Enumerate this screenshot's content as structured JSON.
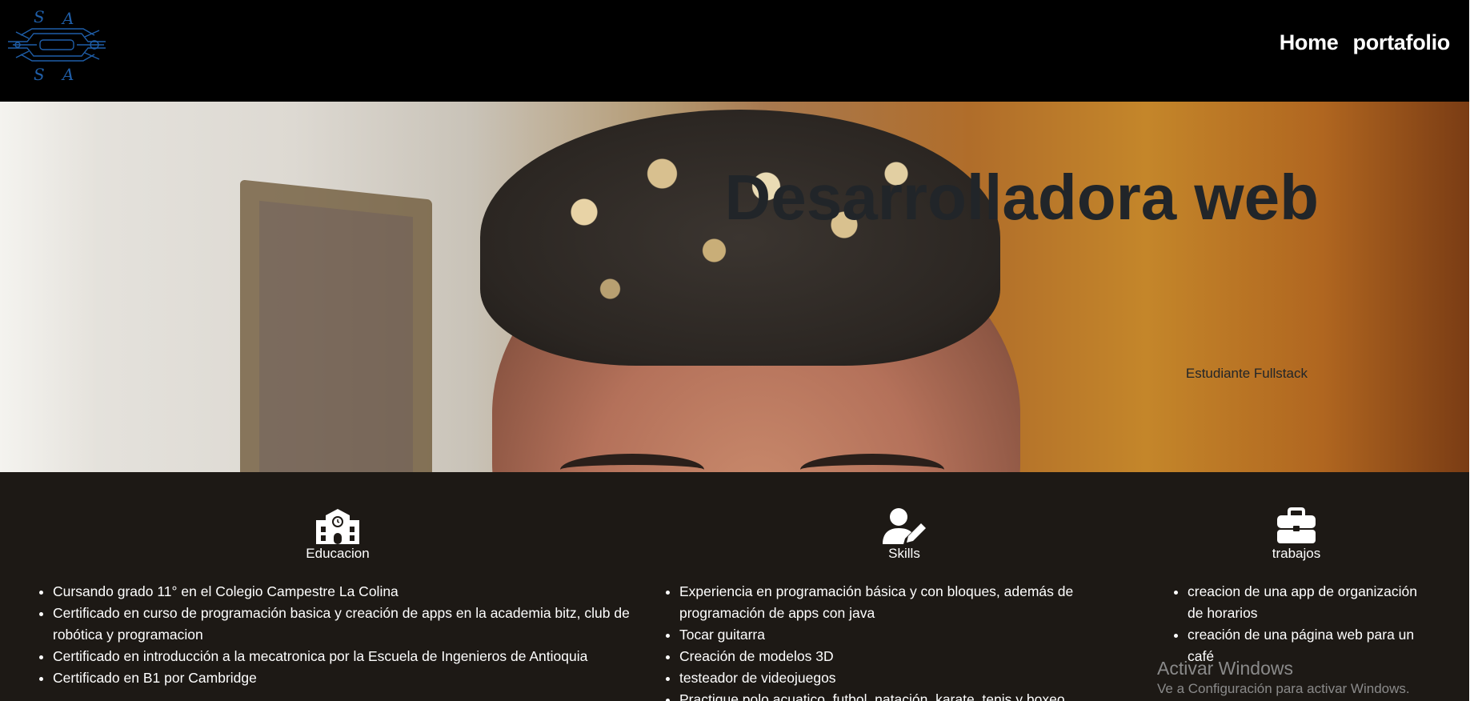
{
  "navbar": {
    "logo_letters": [
      "S",
      "A",
      "S",
      "A"
    ],
    "links": [
      {
        "label": "Home"
      },
      {
        "label": "portafolio"
      }
    ]
  },
  "hero": {
    "title": "Desarrolladora web",
    "subtitle": "Estudiante Fullstack"
  },
  "features": [
    {
      "icon": "school-icon",
      "label": "Educacion",
      "items": [
        "Cursando grado 11° en el Colegio Campestre La Colina",
        "Certificado en curso de programación basica y creación de apps en la academia bitz, club de robótica y programacion",
        "Certificado en introducción a la mecatronica por la Escuela de Ingenieros de Antioquia",
        "Certificado en B1 por Cambridge"
      ]
    },
    {
      "icon": "user-pen-icon",
      "label": "Skills",
      "items": [
        "Experiencia en programación básica y con bloques, además de programación de apps con java",
        "Tocar guitarra",
        "Creación de modelos 3D",
        "testeador de videojuegos",
        "Practique polo acuatico, futbol, natación, karate, tenis y boxeo"
      ]
    },
    {
      "icon": "briefcase-icon",
      "label": "trabajos",
      "items": [
        "creacion de una app de organización de horarios",
        "creación de una página web para un café"
      ]
    }
  ],
  "watermark": {
    "title": "Activar Windows",
    "subtitle": "Ve a Configuración para activar Windows."
  },
  "colors": {
    "navbar_bg": "#000000",
    "section_bg": "#1d1915",
    "hero_text": "#212529",
    "logo_blue": "#1f5ea8"
  }
}
